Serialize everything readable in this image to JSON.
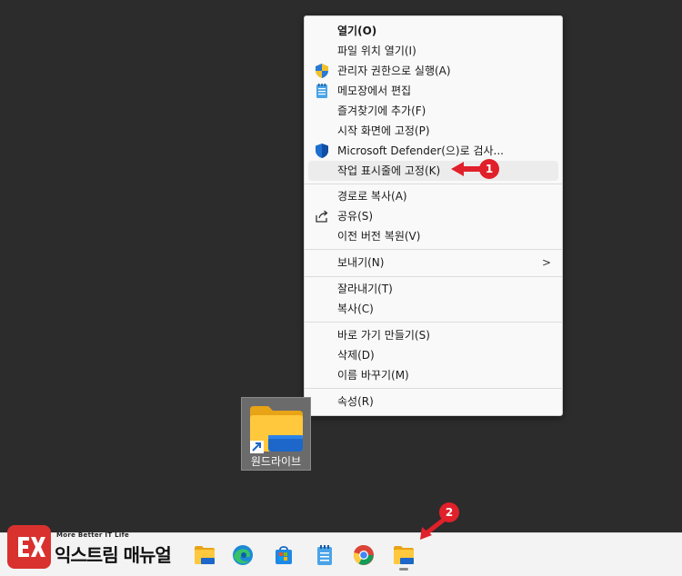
{
  "context_menu": {
    "items": [
      {
        "label": "열기(O)",
        "icon": "none"
      },
      {
        "label": "파일 위치 열기(I)",
        "icon": "none"
      },
      {
        "label": "관리자 권한으로 실행(A)",
        "icon": "uac-shield-icon"
      },
      {
        "label": "메모장에서 편집",
        "icon": "notepad-icon"
      },
      {
        "label": "즐겨찾기에 추가(F)",
        "icon": "none"
      },
      {
        "label": "시작 화면에 고정(P)",
        "icon": "none"
      },
      {
        "label": "Microsoft Defender(으)로 검사...",
        "icon": "defender-shield-icon"
      },
      {
        "label": "작업 표시줄에 고정(K)",
        "icon": "none",
        "highlighted": true
      },
      {
        "label": "경로로 복사(A)",
        "icon": "none"
      },
      {
        "label": "공유(S)",
        "icon": "share-icon"
      },
      {
        "label": "이전 버전 복원(V)",
        "icon": "none"
      },
      {
        "label": "보내기(N)",
        "icon": "none",
        "submenu": ">"
      },
      {
        "label": "잘라내기(T)",
        "icon": "none"
      },
      {
        "label": "복사(C)",
        "icon": "none"
      },
      {
        "label": "바로 가기 만들기(S)",
        "icon": "none"
      },
      {
        "label": "삭제(D)",
        "icon": "none"
      },
      {
        "label": "이름 바꾸기(M)",
        "icon": "none"
      },
      {
        "label": "속성(R)",
        "icon": "none"
      }
    ]
  },
  "callouts": [
    {
      "number": "1",
      "color": "#e0202a"
    },
    {
      "number": "2",
      "color": "#e0202a"
    }
  ],
  "desktop": {
    "shortcut_label": "원드라이브",
    "shortcut_icon": "folder-shortcut-icon",
    "background": "#2c2c2c"
  },
  "taskbar": {
    "apps": [
      {
        "name": "file-explorer",
        "icon": "folder-icon"
      },
      {
        "name": "edge",
        "icon": "edge-icon"
      },
      {
        "name": "store",
        "icon": "store-icon"
      },
      {
        "name": "notepad",
        "icon": "notepad-icon"
      },
      {
        "name": "chrome",
        "icon": "chrome-icon"
      },
      {
        "name": "onedrive-pinned",
        "icon": "folder-icon"
      }
    ]
  },
  "watermark": {
    "tagline": "More Better IT Life",
    "name": "익스트림 매뉴얼"
  }
}
